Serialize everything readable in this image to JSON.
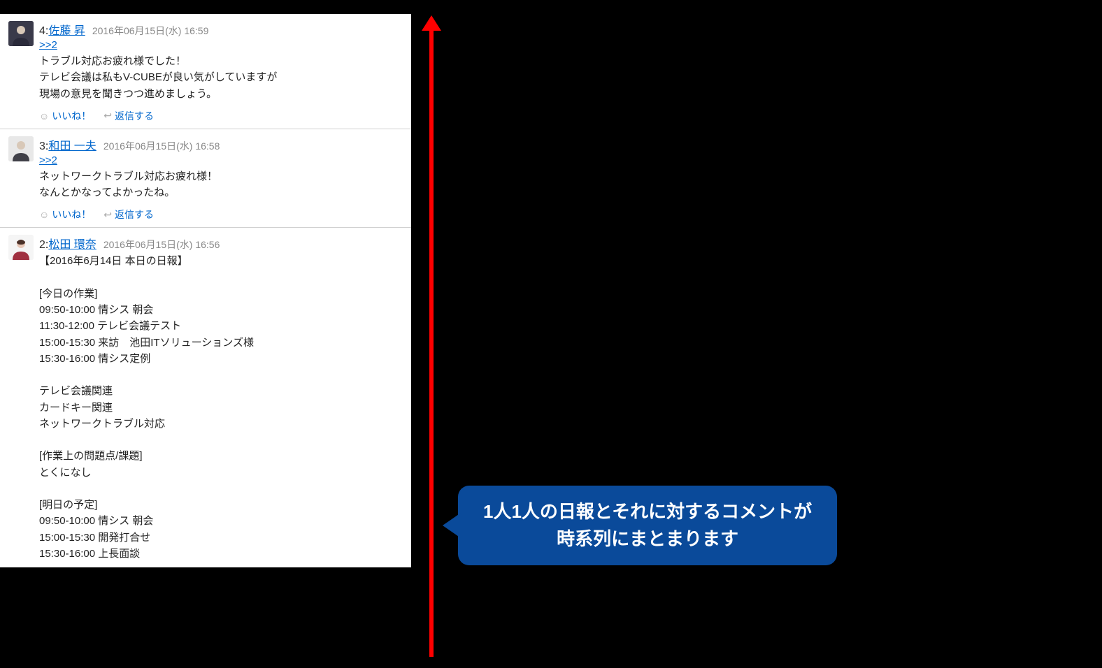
{
  "posts": [
    {
      "num": "4",
      "name": "佐藤 昇",
      "time": "2016年06月15日(水) 16:59",
      "ref": ">>2",
      "body": "トラブル対応お疲れ様でした！\nテレビ会議は私もV-CUBEが良い気がしていますが\n現場の意見を聞きつつ進めましょう。",
      "avatar_bg": "#3a3a4a",
      "has_actions": true
    },
    {
      "num": "3",
      "name": "和田 一夫",
      "time": "2016年06月15日(水) 16:58",
      "ref": ">>2",
      "body": "ネットワークトラブル対応お疲れ様！\nなんとかなってよかったね。",
      "avatar_bg": "#c8c8d0",
      "has_actions": true
    },
    {
      "num": "2",
      "name": "松田 環奈",
      "time": "2016年06月15日(水) 16:56",
      "ref": "",
      "body": "【2016年6月14日 本日の日報】\n\n[今日の作業]\n09:50-10:00  情シス  朝会\n11:30-12:00  テレビ会議テスト\n15:00-15:30  来訪　池田ITソリューションズ様\n15:30-16:00  情シス定例\n\nテレビ会議関連\nカードキー関連\nネットワークトラブル対応\n\n[作業上の問題点/課題]\nとくになし\n\n[明日の予定]\n09:50-10:00  情シス  朝会\n15:00-15:30  開発打合せ\n15:30-16:00  上長面談",
      "avatar_bg": "#b0303a",
      "has_actions": false
    }
  ],
  "actions": {
    "like": "いいね！",
    "reply": "返信する"
  },
  "callout": "1人1人の日報とそれに対するコメントが\n時系列にまとまります"
}
